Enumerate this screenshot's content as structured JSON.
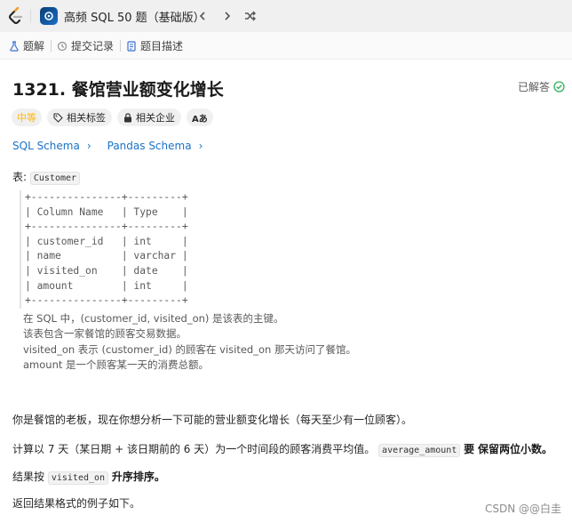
{
  "topbar": {
    "studyplan_title": "高频 SQL 50 题（基础版）"
  },
  "subtabs": [
    {
      "label": "题解",
      "icon": "flask-icon"
    },
    {
      "label": "提交记录",
      "icon": "history-icon"
    },
    {
      "label": "题目描述",
      "icon": "document-icon"
    }
  ],
  "problem": {
    "title": "1321. 餐馆营业额变化增长",
    "solved_label": "已解答",
    "level": "中等",
    "tags": [
      "相关标签",
      "相关企业",
      "Aあ"
    ],
    "schema_links": [
      "SQL Schema",
      "Pandas Schema"
    ]
  },
  "table_intro": {
    "prefix": "表:",
    "table_name": "Customer"
  },
  "schema_table": "+---------------+---------+\n| Column Name   | Type    |\n+---------------+---------+\n| customer_id   | int     |\n| name          | varchar |\n| visited_on    | date    |\n| amount        | int     |\n+---------------+---------+",
  "notes": {
    "line1": "在 SQL 中，(customer_id, visited_on) 是该表的主键。",
    "line2": "该表包含一家餐馆的顾客交易数据。",
    "line3": "visited_on 表示 (customer_id) 的顾客在 visited_on 那天访问了餐馆。",
    "line4": "amount 是一个顾客某一天的消费总额。"
  },
  "paragraphs": {
    "p1": "你是餐馆的老板，现在你想分析一下可能的营业额变化增长（每天至少有一位顾客）。",
    "p2_a": "计算以 7 天（某日期 + 该日期前的 6 天）为一个时间段的顾客消费平均值。",
    "p2_code": "average_amount",
    "p2_b": "要",
    "p2_bold": "保留两位小数。",
    "p3_a": "结果按",
    "p3_code": "visited_on",
    "p3_bold": "升序排序。",
    "p4": "返回结果格式的例子如下。"
  },
  "watermark": "CSDN @@白圭",
  "colors": {
    "accent_link": "#1a73c8",
    "level_medium": "#ffb800",
    "solved_check": "#2db55d"
  }
}
